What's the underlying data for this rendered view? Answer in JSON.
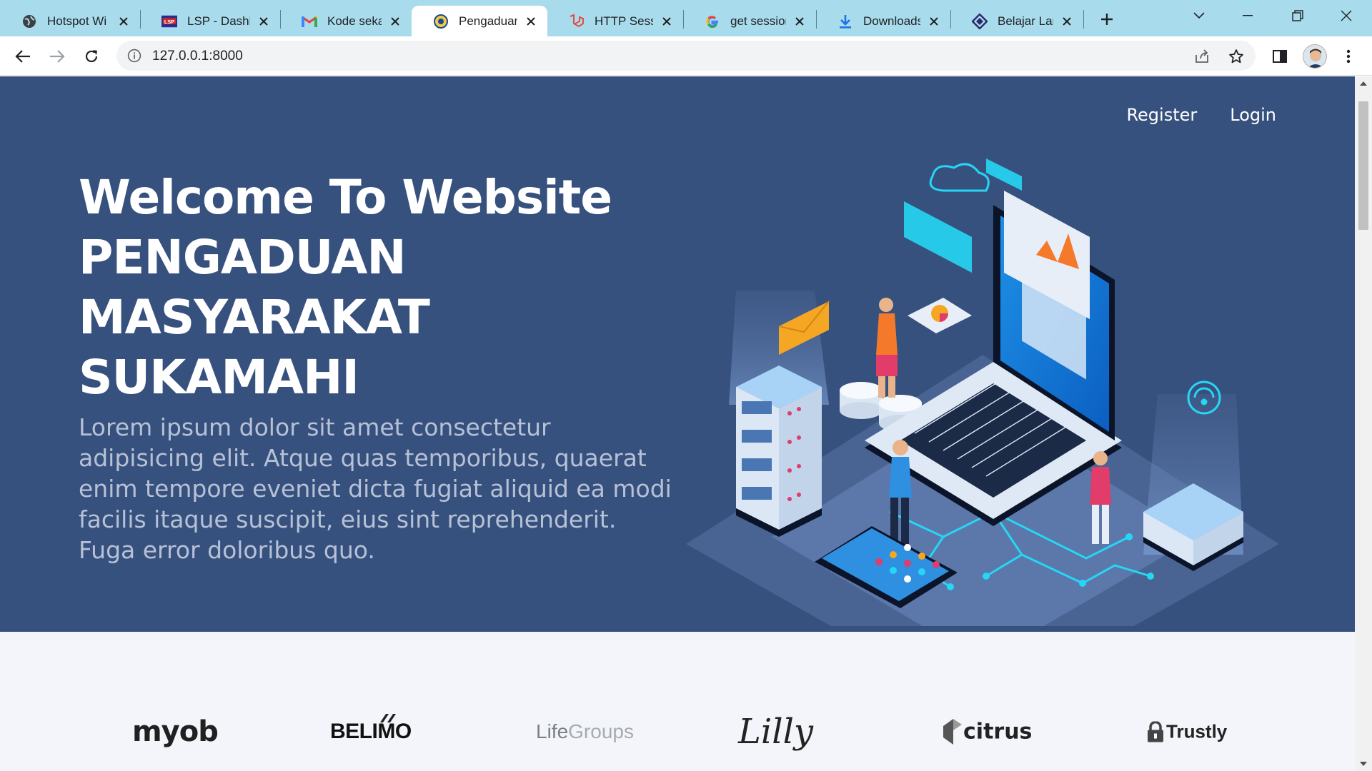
{
  "tabs": [
    {
      "title": "Hotspot Wi",
      "icon": "globe-icon",
      "active": false
    },
    {
      "title": "LSP - Dashb",
      "icon": "lsp-favicon-icon",
      "active": false
    },
    {
      "title": "Kode sekali",
      "icon": "gmail-icon",
      "active": false
    },
    {
      "title": "Pengaduan",
      "icon": "government-seal-icon",
      "active": true
    },
    {
      "title": "HTTP Sessio",
      "icon": "laravel-icon",
      "active": false
    },
    {
      "title": "get session",
      "icon": "google-icon",
      "active": false
    },
    {
      "title": "Downloads",
      "icon": "download-icon",
      "active": false
    },
    {
      "title": "Belajar Lara",
      "icon": "diamond-logo-icon",
      "active": false
    }
  ],
  "address_bar": {
    "url": "127.0.0.1:8000"
  },
  "nav": {
    "register": "Register",
    "login": "Login"
  },
  "hero": {
    "title_line1": "Welcome To Website",
    "title_line2": "PENGADUAN",
    "title_line3": "MASYARAKAT",
    "title_line4": "SUKAMAHI",
    "subtitle": "Lorem ipsum dolor sit amet consectetur adipisicing elit. Atque quas temporibus, quaerat enim tempore eveniet dicta fugiat aliquid ea modi facilis itaque suscipit, eius sint reprehenderit. Fuga error doloribus quo."
  },
  "clients": {
    "myob": "myob",
    "belimo": "BELIMO",
    "lifegroups_life": "Life",
    "lifegroups_groups": "Groups",
    "lilly": "Lilly",
    "citrus": "citrus",
    "trustly": "Trustly"
  },
  "colors": {
    "hero_bg": "#37517e",
    "clients_bg": "#f3f5fa",
    "tabstrip_bg": "#a8dcec",
    "accent_cyan": "#1fc8f0"
  }
}
